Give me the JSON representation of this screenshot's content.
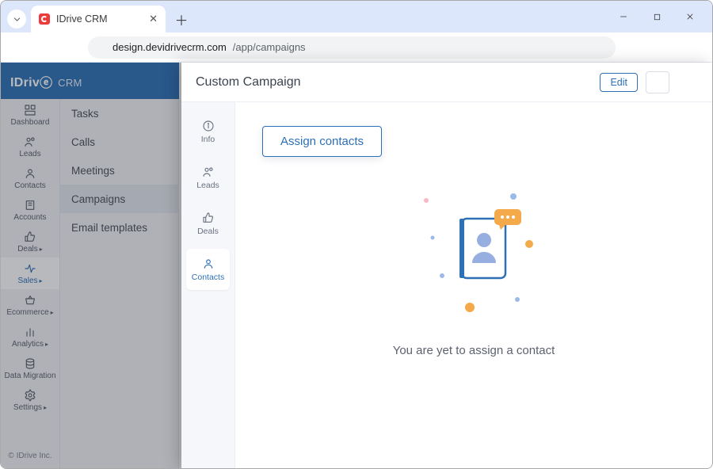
{
  "browser": {
    "tab_title": "IDrive CRM",
    "url_host": "design.devidrivecrm.com",
    "url_path": "/app/campaigns"
  },
  "brand": {
    "logo_primary": "IDriv",
    "logo_e": "e",
    "logo_secondary": "CRM"
  },
  "sidebar": {
    "items": [
      {
        "label": "Dashboard",
        "caret": false
      },
      {
        "label": "Leads",
        "caret": false
      },
      {
        "label": "Contacts",
        "caret": false
      },
      {
        "label": "Accounts",
        "caret": false
      },
      {
        "label": "Deals",
        "caret": true
      },
      {
        "label": "Sales",
        "caret": true
      },
      {
        "label": "Ecommerce",
        "caret": true
      },
      {
        "label": "Analytics",
        "caret": true
      },
      {
        "label": "Data Migration",
        "caret": false
      },
      {
        "label": "Settings",
        "caret": true
      }
    ],
    "footer": "© IDrive Inc."
  },
  "subnav": {
    "items": [
      {
        "label": "Tasks"
      },
      {
        "label": "Calls"
      },
      {
        "label": "Meetings"
      },
      {
        "label": "Campaigns"
      },
      {
        "label": "Email templates"
      }
    ],
    "active_index": 3
  },
  "drawer": {
    "title": "Custom Campaign",
    "edit_label": "Edit",
    "tabs": [
      {
        "label": "Info"
      },
      {
        "label": "Leads"
      },
      {
        "label": "Deals"
      },
      {
        "label": "Contacts"
      }
    ],
    "active_tab_index": 3,
    "assign_button": "Assign contacts",
    "empty_state_text": "You are yet to assign a contact"
  }
}
